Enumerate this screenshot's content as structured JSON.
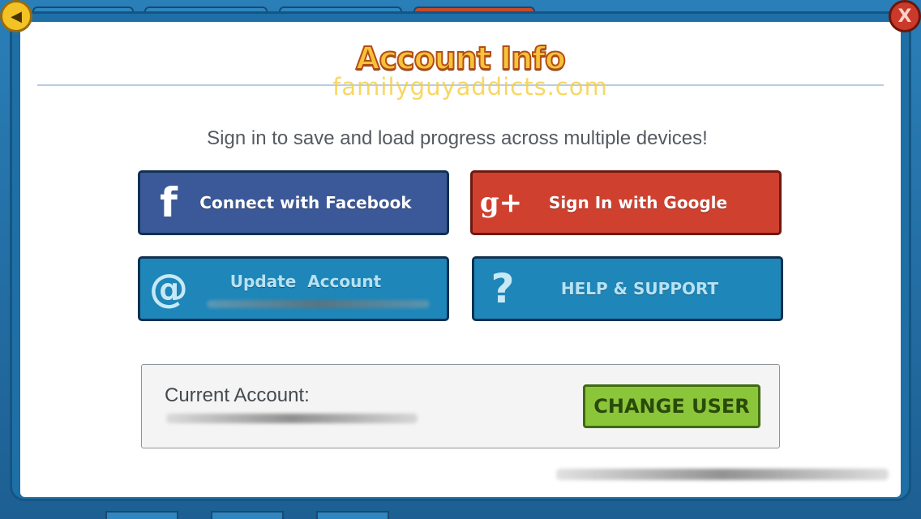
{
  "title": "Account Info",
  "watermark": "familyguyaddicts.com",
  "subtitle": "Sign in to save and load progress across multiple devices!",
  "buttons": {
    "facebook": {
      "label": "Connect with Facebook",
      "icon": "facebook-f-icon"
    },
    "google": {
      "label": "Sign In with Google",
      "icon": "google-plus-icon"
    },
    "update": {
      "label": "Update  Account",
      "icon": "at-sign-icon"
    },
    "help": {
      "label": "HELP & SUPPORT",
      "icon": "question-mark-icon"
    }
  },
  "account": {
    "label": "Current Account:",
    "change_user": "CHANGE USER"
  },
  "nav": {
    "back_icon": "back-arrow-icon",
    "close_label": "X"
  },
  "colors": {
    "facebook": "#3b5998",
    "google": "#d0402f",
    "secondary": "#1e86b8",
    "change_user": "#8bc63a",
    "title": "#f6c23a"
  }
}
